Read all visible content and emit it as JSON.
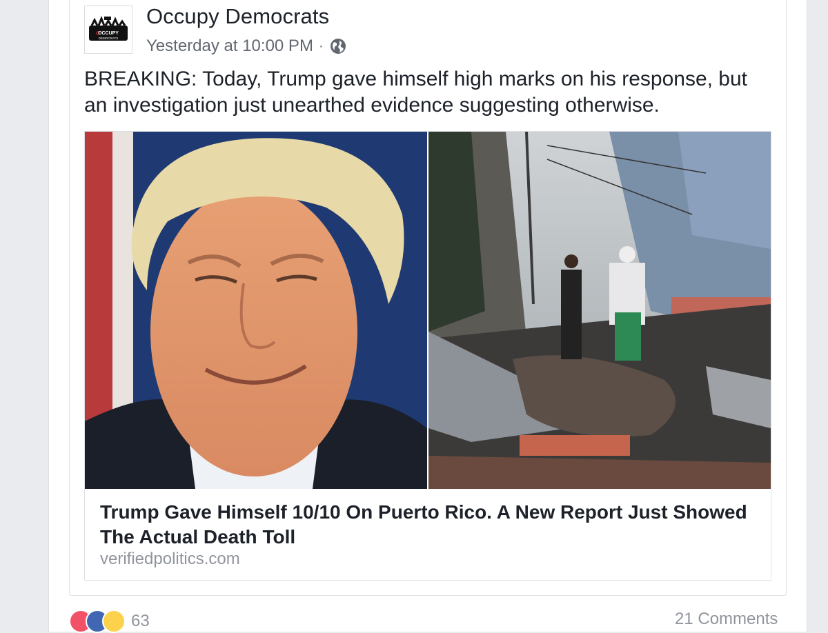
{
  "post": {
    "page_name": "Occupy Democrats",
    "avatar_text": "OCCUPY DEMOCRATS",
    "timestamp": "Yesterday at 10:00 PM",
    "separator": "·",
    "privacy_icon": "globe-icon",
    "text": "BREAKING: Today, Trump gave himself high marks on his response, but an investigation just unearthed evidence suggesting otherwise."
  },
  "link": {
    "title": "Trump Gave Himself 10/10 On Puerto Rico. A New Report Just Showed The Actual Death Toll",
    "domain": "verifiedpolitics.com"
  },
  "footer": {
    "reaction_count": "63",
    "comments_label": "21 Comments"
  },
  "colors": {
    "like_blue": "#4267b2",
    "love_red": "#f25268",
    "haha_yellow": "#fcd14b",
    "text_dark": "#1d2129",
    "text_muted": "#90949c"
  }
}
